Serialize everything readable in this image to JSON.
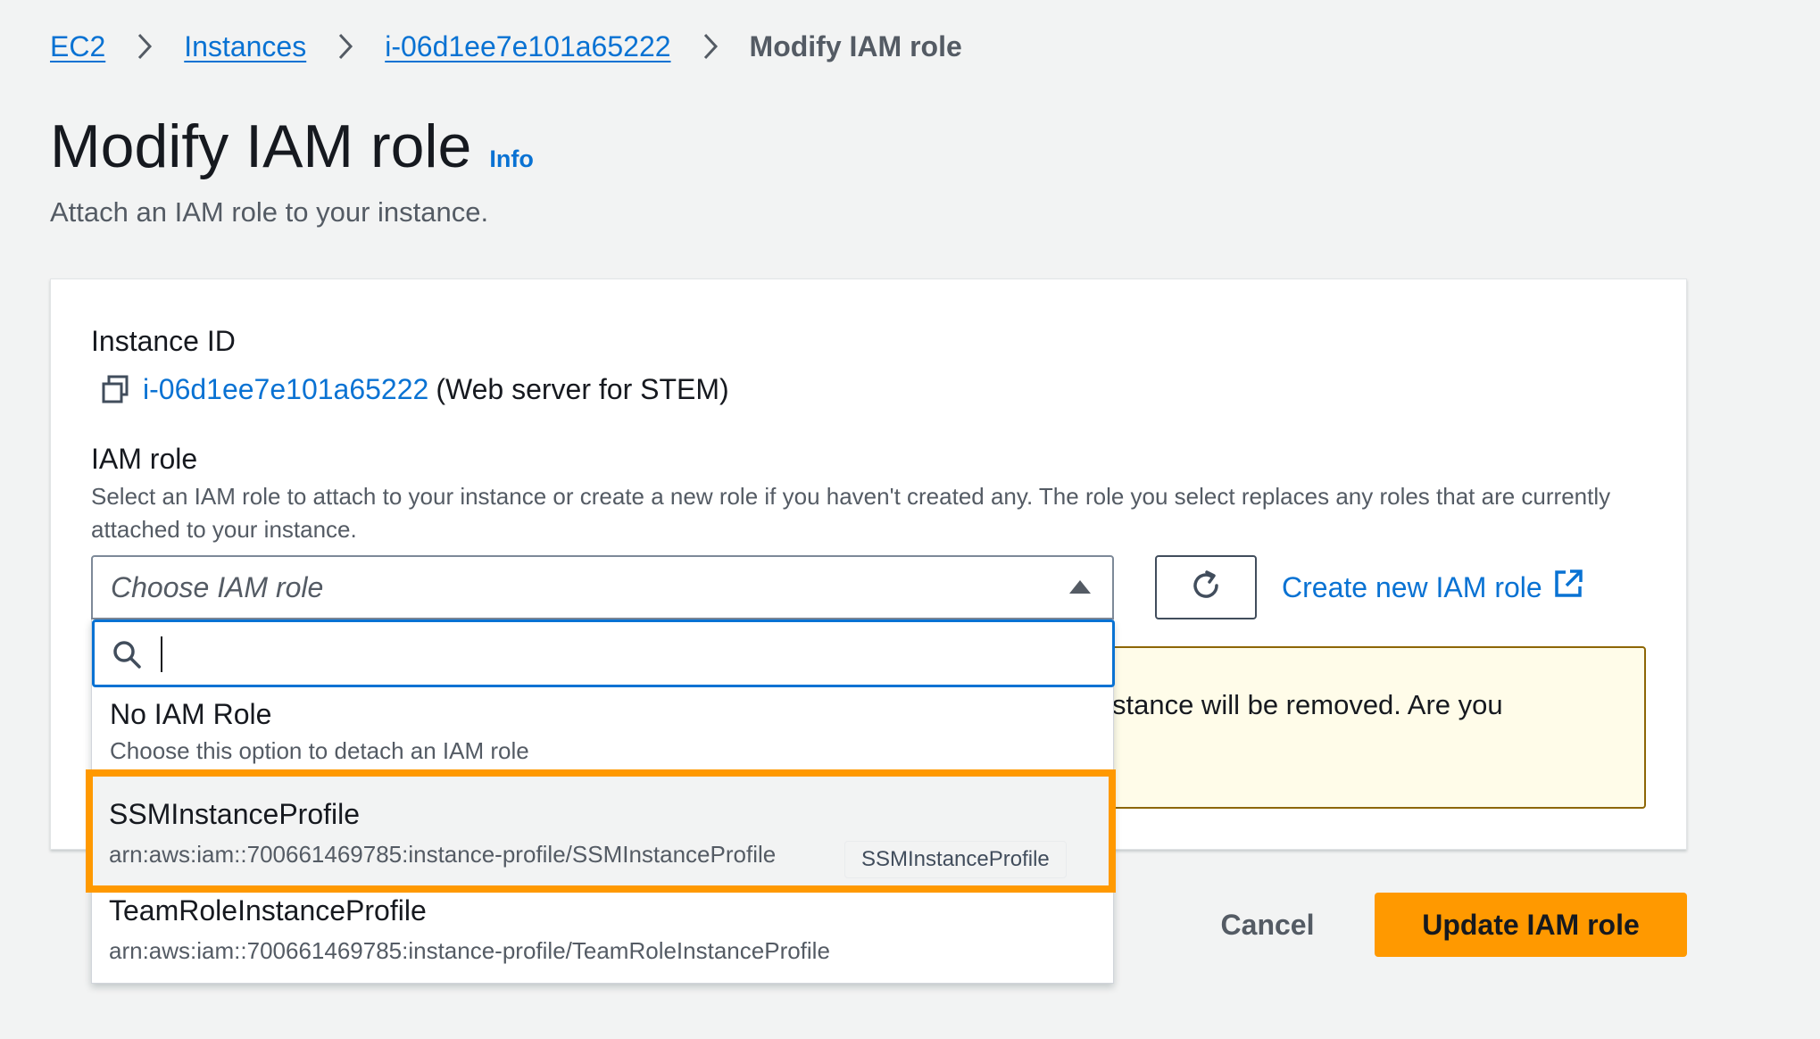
{
  "breadcrumb": {
    "items": [
      "EC2",
      "Instances",
      "i-06d1ee7e101a65222"
    ],
    "current": "Modify IAM role"
  },
  "header": {
    "title": "Modify IAM role",
    "info": "Info",
    "subtitle": "Attach an IAM role to your instance."
  },
  "instance": {
    "label": "Instance ID",
    "id": "i-06d1ee7e101a65222",
    "name": "(Web server for STEM)"
  },
  "iam_role": {
    "label": "IAM role",
    "description": "Select an IAM role to attach to your instance or create a new role if you haven't created any. The role you select replaces any roles that are currently attached to your instance.",
    "placeholder": "Choose IAM role",
    "create_link": "Create new IAM role",
    "search_value": "",
    "options": [
      {
        "label": "No IAM Role",
        "description": "Choose this option to detach an IAM role"
      },
      {
        "label": "SSMInstanceProfile",
        "description": "arn:aws:iam::700661469785:instance-profile/SSMInstanceProfile",
        "tag": "SSMInstanceProfile"
      },
      {
        "label": "TeamRoleInstanceProfile",
        "description": "arn:aws:iam::700661469785:instance-profile/TeamRoleInstanceProfile"
      }
    ]
  },
  "alert": {
    "text": "e instance will be removed. Are you"
  },
  "footer": {
    "cancel_label": "Cancel",
    "update_label": "Update IAM role"
  },
  "colors": {
    "link": "#0972d3",
    "primary": "#ff9900",
    "highlight": "#ff9900",
    "warning_bg": "#fffce9",
    "warning_border": "#8d6605"
  },
  "icons": [
    "chevron-right-icon",
    "copy-icon",
    "caret-up-icon",
    "refresh-icon",
    "external-link-icon",
    "search-icon"
  ]
}
